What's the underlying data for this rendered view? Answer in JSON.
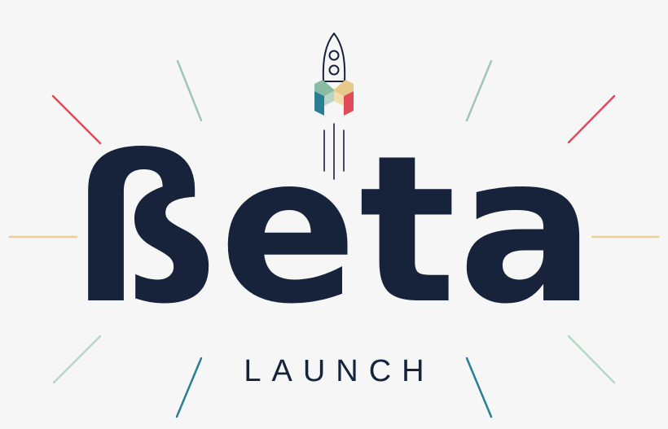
{
  "logo": {
    "headline": "ßeta",
    "subline": "LAUNCH"
  },
  "colors": {
    "background": "#f6f6f7",
    "navy": "#16233b",
    "red": "#e04b57",
    "sage": "#9fc6b4",
    "sand": "#ebcf95",
    "teal": "#2a7e94",
    "mint": "#88bca5",
    "gold": "#e9c98a"
  },
  "icons": [
    "rocket-icon",
    "m-cube-icon",
    "ray-burst"
  ]
}
